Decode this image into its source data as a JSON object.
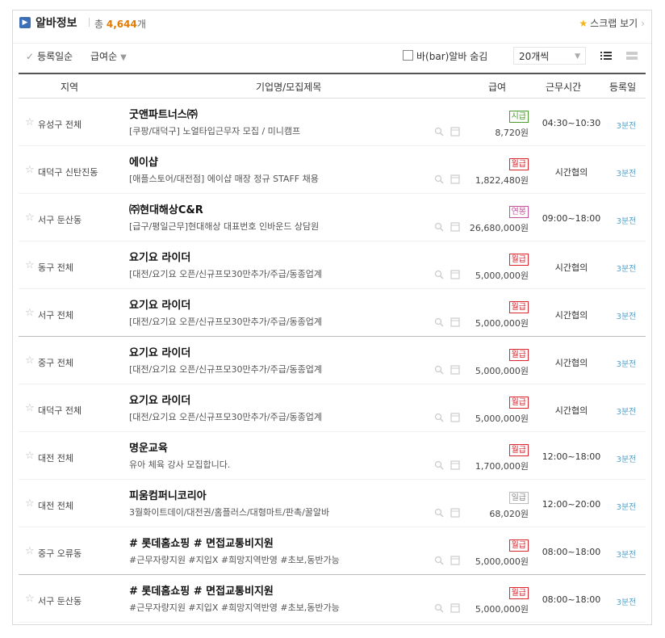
{
  "header": {
    "title": "알바정보",
    "total_prefix": "총",
    "total_count": "4,644",
    "total_suffix": "개",
    "scrap_label": "스크랩 보기"
  },
  "toolbar": {
    "sort_date": "등록일순",
    "sort_pay": "급여순",
    "bar_filter": "바(bar)알바 숨김",
    "per_page": "20개씩"
  },
  "columns": {
    "region": "지역",
    "title": "기업명/모집제목",
    "pay": "급여",
    "hours": "근무시간",
    "posted": "등록일"
  },
  "badge_colors": {
    "시급": "#4c9b2f",
    "월급": "#d9262f",
    "연봉": "#c4519c",
    "일급": "#888888"
  },
  "rows": [
    {
      "region": "유성구 전체",
      "company": "굿앤파트너스㈜",
      "title": "[쿠팡/대덕구] 노얼타입근무자 모집 / 미니캠프",
      "pay_type": "시급",
      "amount": "8,720원",
      "hours": "04:30~10:30",
      "posted": "3분전"
    },
    {
      "region": "대덕구 신탄진동",
      "company": "에이샵",
      "title": "[애플스토어/대전점] 에이샵 매장 정규 STAFF 채용",
      "pay_type": "월급",
      "amount": "1,822,480원",
      "hours": "시간협의",
      "posted": "3분전"
    },
    {
      "region": "서구 둔산동",
      "company": "㈜현대해상C&R",
      "title": "[급구/평일근무]현대해상 대표번호 인바운드 상담원",
      "pay_type": "연봉",
      "amount": "26,680,000원",
      "hours": "09:00~18:00",
      "posted": "3분전"
    },
    {
      "region": "동구 전체",
      "company": "요기요 라이더",
      "title": "[대전/요기요 오픈/신규프모30만추가/주급/동종업계",
      "pay_type": "월급",
      "amount": "5,000,000원",
      "hours": "시간협의",
      "posted": "3분전"
    },
    {
      "region": "서구 전체",
      "company": "요기요 라이더",
      "title": "[대전/요기요 오픈/신규프모30만추가/주급/동종업계",
      "pay_type": "월급",
      "amount": "5,000,000원",
      "hours": "시간협의",
      "posted": "3분전"
    },
    {
      "region": "중구 전체",
      "company": "요기요 라이더",
      "title": "[대전/요기요 오픈/신규프모30만추가/주급/동종업계",
      "pay_type": "월급",
      "amount": "5,000,000원",
      "hours": "시간협의",
      "posted": "3분전"
    },
    {
      "region": "대덕구 전체",
      "company": "요기요 라이더",
      "title": "[대전/요기요 오픈/신규프모30만추가/주급/동종업계",
      "pay_type": "월급",
      "amount": "5,000,000원",
      "hours": "시간협의",
      "posted": "3분전"
    },
    {
      "region": "대전 전체",
      "company": "명운교육",
      "title": "유아 체육 강사 모집합니다.",
      "pay_type": "월급",
      "amount": "1,700,000원",
      "hours": "12:00~18:00",
      "posted": "3분전"
    },
    {
      "region": "대전 전체",
      "company": "피움컴퍼니코리아",
      "title": "3월화이트데이/대전권/홈플러스/대형마트/판촉/꿀알바",
      "pay_type": "일급",
      "amount": "68,020원",
      "hours": "12:00~20:00",
      "posted": "3분전"
    },
    {
      "region": "중구 오류동",
      "company": "# 롯데홈쇼핑 # 면접교통비지원",
      "title": "#근무자량지원 #지입X #희망지역반영 #초보,동반가능",
      "pay_type": "월급",
      "amount": "5,000,000원",
      "hours": "08:00~18:00",
      "posted": "3분전"
    },
    {
      "region": "서구 둔산동",
      "company": "# 롯데홈쇼핑 # 면접교통비지원",
      "title": "#근무자량지원 #지입X #희망지역반영 #초보,동반가능",
      "pay_type": "월급",
      "amount": "5,000,000원",
      "hours": "08:00~18:00",
      "posted": "3분전"
    }
  ]
}
